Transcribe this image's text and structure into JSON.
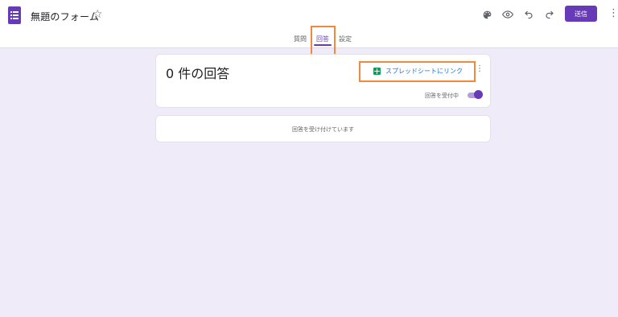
{
  "app": {
    "title": "無題のフォーム",
    "icons": {
      "logo": "forms-logo-icon",
      "star": "star-outline-icon",
      "palette": "palette-icon",
      "preview": "eye-icon",
      "undo": "undo-icon",
      "redo": "redo-icon",
      "more": "more-vert-icon"
    },
    "send_label": "送信",
    "accent_color": "#673ab7",
    "background_color": "#f0ebf8"
  },
  "tabs": [
    {
      "label": "質問",
      "active": false
    },
    {
      "label": "回答",
      "active": true
    },
    {
      "label": "設定",
      "active": false
    }
  ],
  "responses": {
    "count_title": "0 件の回答",
    "link_sheets_label": "スプレッドシートにリンク",
    "sheets_icon": "google-sheets-icon",
    "accepting_label": "回答を受付中",
    "accepting": true,
    "empty_message": "回答を受け付けています"
  },
  "highlight_color": "#f0883e"
}
